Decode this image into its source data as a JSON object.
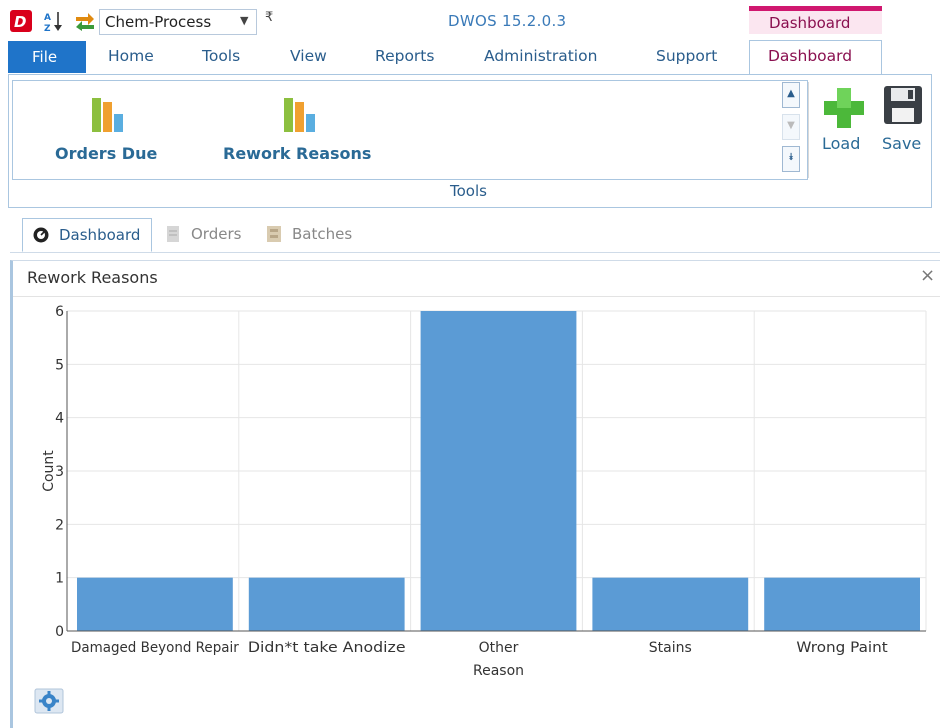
{
  "qat": {
    "logo_icon": "app-logo-icon",
    "sort_icon": "sort-az-icon",
    "switch_icon": "switch-icon",
    "process_selector": "Chem-Process",
    "more_icon": "qat-customize-icon"
  },
  "app_title": "DWOS 15.2.0.3",
  "context_header": "Dashboard",
  "ribbon_tabs": {
    "file": "File",
    "home": "Home",
    "tools": "Tools",
    "view": "View",
    "reports": "Reports",
    "administration": "Administration",
    "support": "Support",
    "dashboard": "Dashboard"
  },
  "ribbon": {
    "orders_due": "Orders Due",
    "rework_reasons": "Rework Reasons",
    "group_label": "Tools",
    "load": "Load",
    "save": "Save"
  },
  "doc_tabs": {
    "dashboard": "Dashboard",
    "orders": "Orders",
    "batches": "Batches"
  },
  "panel": {
    "title": "Rework Reasons",
    "close": "×"
  },
  "colors": {
    "accent": "#1f74c9",
    "context": "#d0176f",
    "bar": "#5b9bd5"
  },
  "chart_data": {
    "type": "bar",
    "categories": [
      "Damaged Beyond Repair",
      "Didn*t take Anodize",
      "Other",
      "Stains",
      "Wrong Paint"
    ],
    "values": [
      1,
      1,
      6,
      1,
      1
    ],
    "xlabel": "Reason",
    "ylabel": "Count",
    "ylim": [
      0,
      6
    ],
    "yticks": [
      0,
      1,
      2,
      3,
      4,
      5,
      6
    ],
    "grid": true
  }
}
